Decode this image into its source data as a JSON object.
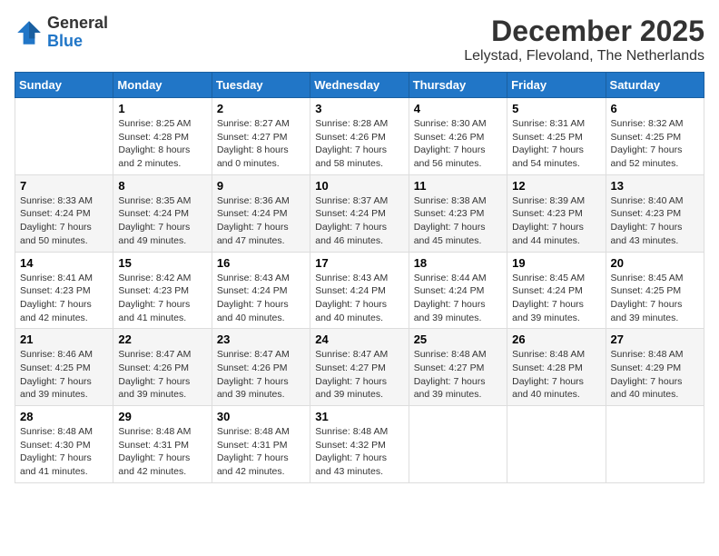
{
  "header": {
    "logo_general": "General",
    "logo_blue": "Blue",
    "month_title": "December 2025",
    "location": "Lelystad, Flevoland, The Netherlands"
  },
  "calendar": {
    "days_of_week": [
      "Sunday",
      "Monday",
      "Tuesday",
      "Wednesday",
      "Thursday",
      "Friday",
      "Saturday"
    ],
    "weeks": [
      [
        {
          "day": "",
          "info": ""
        },
        {
          "day": "1",
          "info": "Sunrise: 8:25 AM\nSunset: 4:28 PM\nDaylight: 8 hours\nand 2 minutes."
        },
        {
          "day": "2",
          "info": "Sunrise: 8:27 AM\nSunset: 4:27 PM\nDaylight: 8 hours\nand 0 minutes."
        },
        {
          "day": "3",
          "info": "Sunrise: 8:28 AM\nSunset: 4:26 PM\nDaylight: 7 hours\nand 58 minutes."
        },
        {
          "day": "4",
          "info": "Sunrise: 8:30 AM\nSunset: 4:26 PM\nDaylight: 7 hours\nand 56 minutes."
        },
        {
          "day": "5",
          "info": "Sunrise: 8:31 AM\nSunset: 4:25 PM\nDaylight: 7 hours\nand 54 minutes."
        },
        {
          "day": "6",
          "info": "Sunrise: 8:32 AM\nSunset: 4:25 PM\nDaylight: 7 hours\nand 52 minutes."
        }
      ],
      [
        {
          "day": "7",
          "info": "Sunrise: 8:33 AM\nSunset: 4:24 PM\nDaylight: 7 hours\nand 50 minutes."
        },
        {
          "day": "8",
          "info": "Sunrise: 8:35 AM\nSunset: 4:24 PM\nDaylight: 7 hours\nand 49 minutes."
        },
        {
          "day": "9",
          "info": "Sunrise: 8:36 AM\nSunset: 4:24 PM\nDaylight: 7 hours\nand 47 minutes."
        },
        {
          "day": "10",
          "info": "Sunrise: 8:37 AM\nSunset: 4:24 PM\nDaylight: 7 hours\nand 46 minutes."
        },
        {
          "day": "11",
          "info": "Sunrise: 8:38 AM\nSunset: 4:23 PM\nDaylight: 7 hours\nand 45 minutes."
        },
        {
          "day": "12",
          "info": "Sunrise: 8:39 AM\nSunset: 4:23 PM\nDaylight: 7 hours\nand 44 minutes."
        },
        {
          "day": "13",
          "info": "Sunrise: 8:40 AM\nSunset: 4:23 PM\nDaylight: 7 hours\nand 43 minutes."
        }
      ],
      [
        {
          "day": "14",
          "info": "Sunrise: 8:41 AM\nSunset: 4:23 PM\nDaylight: 7 hours\nand 42 minutes."
        },
        {
          "day": "15",
          "info": "Sunrise: 8:42 AM\nSunset: 4:23 PM\nDaylight: 7 hours\nand 41 minutes."
        },
        {
          "day": "16",
          "info": "Sunrise: 8:43 AM\nSunset: 4:24 PM\nDaylight: 7 hours\nand 40 minutes."
        },
        {
          "day": "17",
          "info": "Sunrise: 8:43 AM\nSunset: 4:24 PM\nDaylight: 7 hours\nand 40 minutes."
        },
        {
          "day": "18",
          "info": "Sunrise: 8:44 AM\nSunset: 4:24 PM\nDaylight: 7 hours\nand 39 minutes."
        },
        {
          "day": "19",
          "info": "Sunrise: 8:45 AM\nSunset: 4:24 PM\nDaylight: 7 hours\nand 39 minutes."
        },
        {
          "day": "20",
          "info": "Sunrise: 8:45 AM\nSunset: 4:25 PM\nDaylight: 7 hours\nand 39 minutes."
        }
      ],
      [
        {
          "day": "21",
          "info": "Sunrise: 8:46 AM\nSunset: 4:25 PM\nDaylight: 7 hours\nand 39 minutes."
        },
        {
          "day": "22",
          "info": "Sunrise: 8:47 AM\nSunset: 4:26 PM\nDaylight: 7 hours\nand 39 minutes."
        },
        {
          "day": "23",
          "info": "Sunrise: 8:47 AM\nSunset: 4:26 PM\nDaylight: 7 hours\nand 39 minutes."
        },
        {
          "day": "24",
          "info": "Sunrise: 8:47 AM\nSunset: 4:27 PM\nDaylight: 7 hours\nand 39 minutes."
        },
        {
          "day": "25",
          "info": "Sunrise: 8:48 AM\nSunset: 4:27 PM\nDaylight: 7 hours\nand 39 minutes."
        },
        {
          "day": "26",
          "info": "Sunrise: 8:48 AM\nSunset: 4:28 PM\nDaylight: 7 hours\nand 40 minutes."
        },
        {
          "day": "27",
          "info": "Sunrise: 8:48 AM\nSunset: 4:29 PM\nDaylight: 7 hours\nand 40 minutes."
        }
      ],
      [
        {
          "day": "28",
          "info": "Sunrise: 8:48 AM\nSunset: 4:30 PM\nDaylight: 7 hours\nand 41 minutes."
        },
        {
          "day": "29",
          "info": "Sunrise: 8:48 AM\nSunset: 4:31 PM\nDaylight: 7 hours\nand 42 minutes."
        },
        {
          "day": "30",
          "info": "Sunrise: 8:48 AM\nSunset: 4:31 PM\nDaylight: 7 hours\nand 42 minutes."
        },
        {
          "day": "31",
          "info": "Sunrise: 8:48 AM\nSunset: 4:32 PM\nDaylight: 7 hours\nand 43 minutes."
        },
        {
          "day": "",
          "info": ""
        },
        {
          "day": "",
          "info": ""
        },
        {
          "day": "",
          "info": ""
        }
      ]
    ]
  }
}
